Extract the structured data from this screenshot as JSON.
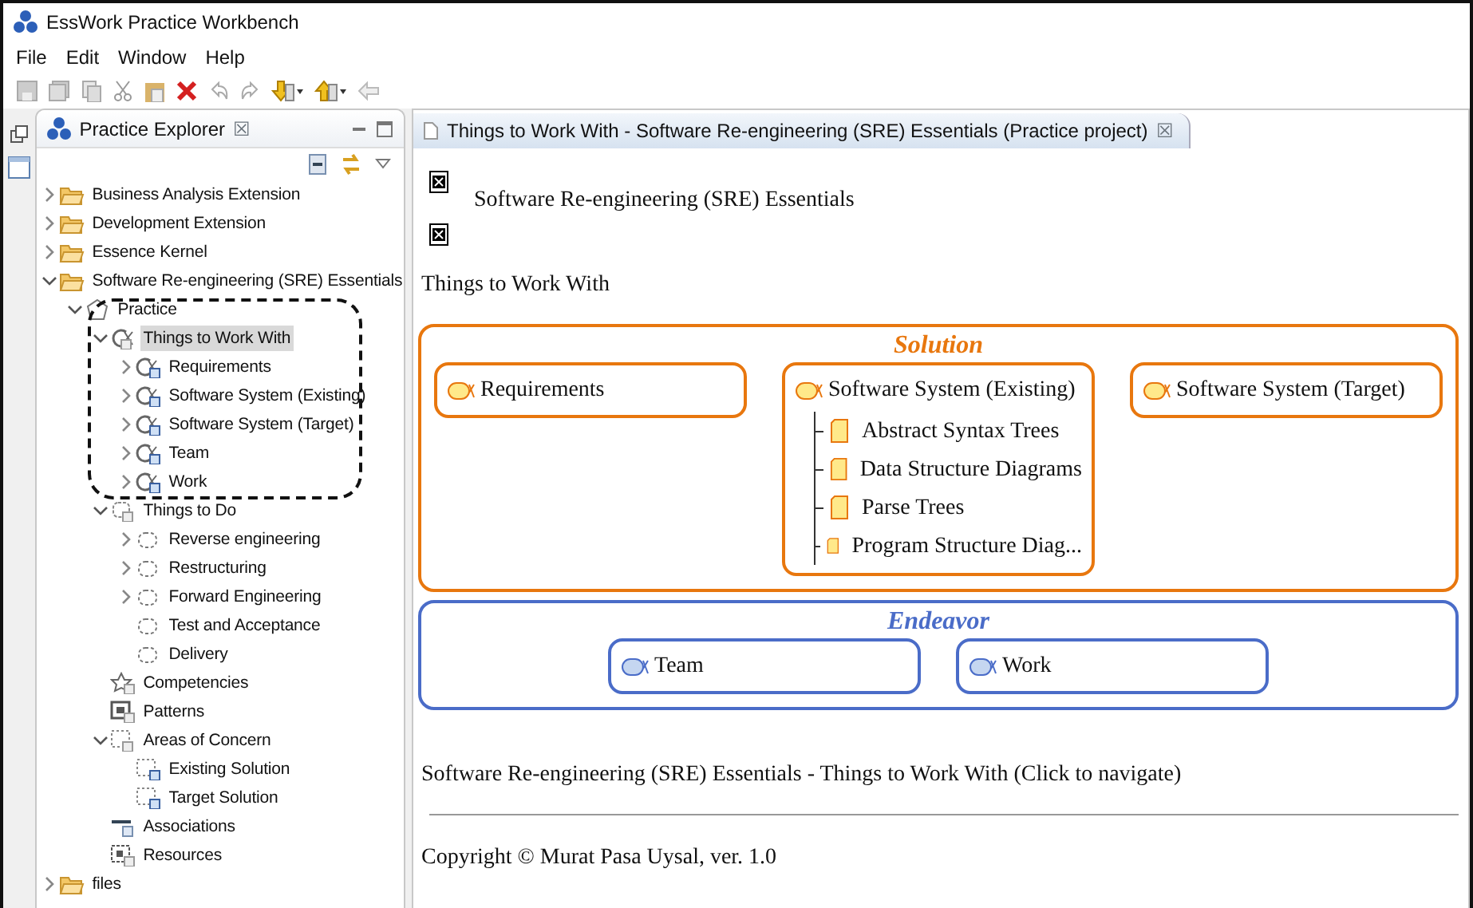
{
  "window": {
    "title": "EssWork Practice Workbench"
  },
  "menu": [
    "File",
    "Edit",
    "Window",
    "Help"
  ],
  "explorer": {
    "title": "Practice Explorer",
    "close": "☒",
    "tree": [
      {
        "label": "Business Analysis Extension",
        "kind": "folder",
        "expanded": false,
        "selected": false
      },
      {
        "label": "Development Extension",
        "kind": "folder",
        "expanded": false,
        "selected": false
      },
      {
        "label": "Essence Kernel",
        "kind": "folder",
        "expanded": false,
        "selected": false
      },
      {
        "label": "Software Re-engineering (SRE) Essentials",
        "kind": "folder",
        "expanded": true,
        "selected": false,
        "children": [
          {
            "label": "Practice",
            "kind": "practice",
            "expanded": true,
            "selected": false,
            "children": [
              {
                "label": "Things to Work With",
                "kind": "alphas",
                "expanded": true,
                "selected": true,
                "children": [
                  {
                    "label": "Requirements",
                    "kind": "alpha",
                    "expanded": false,
                    "selected": false
                  },
                  {
                    "label": "Software System (Existing)",
                    "kind": "alpha",
                    "expanded": false,
                    "selected": false
                  },
                  {
                    "label": "Software System (Target)",
                    "kind": "alpha",
                    "expanded": false,
                    "selected": false
                  },
                  {
                    "label": "Team",
                    "kind": "alpha",
                    "expanded": false,
                    "selected": false
                  },
                  {
                    "label": "Work",
                    "kind": "alpha",
                    "expanded": false,
                    "selected": false
                  }
                ]
              },
              {
                "label": "Things to Do",
                "kind": "spaces",
                "expanded": true,
                "selected": false,
                "children": [
                  {
                    "label": "Reverse engineering",
                    "kind": "space",
                    "expanded": false,
                    "selected": false
                  },
                  {
                    "label": "Restructuring",
                    "kind": "space",
                    "expanded": false,
                    "selected": false
                  },
                  {
                    "label": "Forward Engineering",
                    "kind": "space",
                    "expanded": false,
                    "selected": false
                  },
                  {
                    "label": "Test and Acceptance",
                    "kind": "space",
                    "selected": false
                  },
                  {
                    "label": "Delivery",
                    "kind": "space",
                    "selected": false
                  }
                ]
              },
              {
                "label": "Competencies",
                "kind": "competency",
                "selected": false
              },
              {
                "label": "Patterns",
                "kind": "pattern",
                "selected": false
              },
              {
                "label": "Areas of Concern",
                "kind": "areas",
                "expanded": true,
                "selected": false,
                "children": [
                  {
                    "label": "Existing Solution",
                    "kind": "area",
                    "selected": false
                  },
                  {
                    "label": "Target Solution",
                    "kind": "area",
                    "selected": false
                  }
                ]
              },
              {
                "label": "Associations",
                "kind": "association",
                "selected": false
              },
              {
                "label": "Resources",
                "kind": "resource",
                "selected": false
              }
            ]
          }
        ]
      },
      {
        "label": "files",
        "kind": "folder",
        "expanded": false,
        "selected": false
      }
    ]
  },
  "editor": {
    "tab": "Things to Work With - Software Re-engineering (SRE) Essentials (Practice project)",
    "close": "☒",
    "heading": "Software Re-engineering (SRE) Essentials",
    "subheading": "Things to Work With",
    "areas": [
      {
        "title": "Solution",
        "color": "#e8770e",
        "alphas": [
          {
            "name": "Requirements"
          },
          {
            "name": "Software System (Existing)",
            "children": [
              "Abstract Syntax Trees",
              "Data Structure Diagrams",
              "Parse Trees",
              "Program Structure Diag..."
            ]
          },
          {
            "name": "Software System (Target)"
          }
        ]
      },
      {
        "title": "Endeavor",
        "color": "#4a6cc8",
        "alphas": [
          {
            "name": "Team"
          },
          {
            "name": "Work"
          }
        ]
      }
    ],
    "link": "Software Re-engineering (SRE) Essentials - Things to Work With (Click to navigate)",
    "copyright": "Copyright © Murat Pasa Uysal, ver. 1.0"
  }
}
